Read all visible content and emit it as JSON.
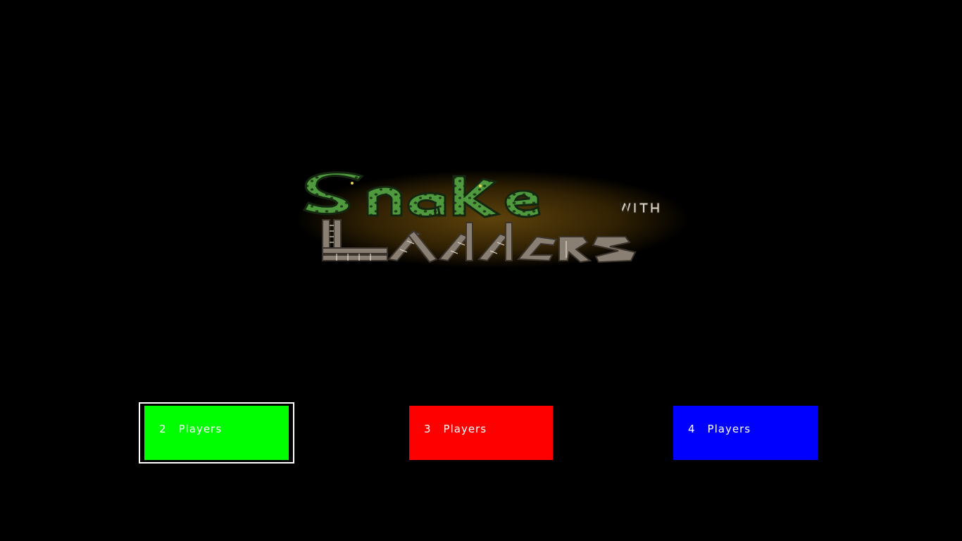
{
  "logo": {
    "alt": "Snake with Ladders",
    "word1": "Snake",
    "word2": "WITH",
    "word3": "Ladders",
    "colors": {
      "snake_fill": "#4f9a3f",
      "snake_dark": "#1f3d17",
      "ladder": "#8a7f73",
      "ladder_dark": "#3b342c",
      "glow": "#b07e18"
    }
  },
  "buttons": [
    {
      "id": "2",
      "number": "2",
      "label": "Players",
      "color": "#00ff00",
      "selected": true
    },
    {
      "id": "3",
      "number": "3",
      "label": "Players",
      "color": "#ff0000",
      "selected": false
    },
    {
      "id": "4",
      "number": "4",
      "label": "Players",
      "color": "#0000ff",
      "selected": false
    }
  ]
}
